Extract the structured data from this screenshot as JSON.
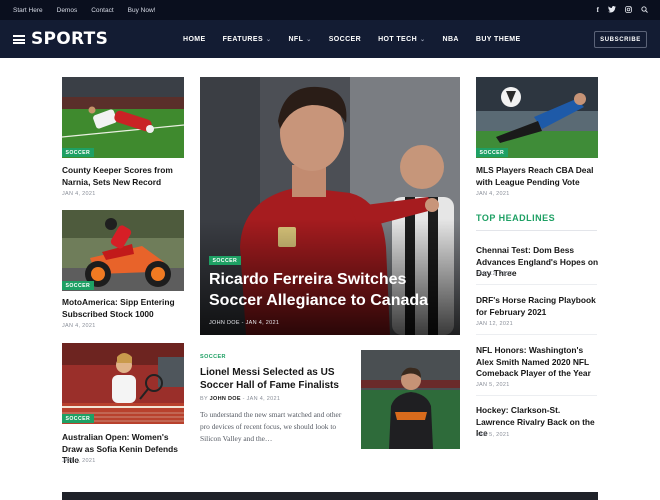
{
  "topbar": {
    "links": [
      "Start Here",
      "Demos",
      "Contact",
      "Buy Now!"
    ],
    "icons": [
      "facebook-icon",
      "twitter-icon",
      "instagram-icon",
      "search-icon"
    ]
  },
  "header": {
    "logo": "SPORTS",
    "nav": [
      {
        "label": "HOME",
        "dropdown": false
      },
      {
        "label": "FEATURES",
        "dropdown": true
      },
      {
        "label": "NFL",
        "dropdown": true
      },
      {
        "label": "SOCCER",
        "dropdown": false
      },
      {
        "label": "HOT TECH",
        "dropdown": true
      },
      {
        "label": "NBA",
        "dropdown": false
      },
      {
        "label": "BUY THEME",
        "dropdown": false
      }
    ],
    "subscribe_label": "SUBSCRIBE"
  },
  "left_column": [
    {
      "category": "SOCCER",
      "title": "County Keeper Scores from Narnia, Sets New Record",
      "date": "JAN 4, 2021"
    },
    {
      "category": "SOCCER",
      "title": "MotoAmerica: Sipp Entering Subscribed Stock 1000",
      "date": "JAN 4, 2021"
    },
    {
      "category": "SOCCER",
      "title": "Australian Open: Women's Draw as Sofia Kenin Defends Title",
      "date": "JAN 4, 2021"
    }
  ],
  "feature": {
    "category": "SOCCER",
    "title": "Ricardo Ferreira Switches Soccer Allegiance to Canada",
    "author": "JOHN DOE",
    "date": "JAN 4, 2021"
  },
  "middle_post": {
    "category": "SOCCER",
    "title": "Lionel Messi Selected as US Soccer Hall of Fame Finalists",
    "by": "BY",
    "author": "JOHN DOE",
    "date": "JAN 4, 2021",
    "excerpt": "To understand the new smart watched and other pro devices of recent focus, we should look to Silicon Valley and the…"
  },
  "right_top": {
    "category": "SOCCER",
    "title": "MLS Players Reach CBA Deal with League Pending Vote",
    "date": "JAN 4, 2021"
  },
  "top_headlines": {
    "heading": "TOP HEADLINES",
    "items": [
      {
        "title": "Chennai Test: Dom Bess Advances England's Hopes on Day Three",
        "date": "JAN 12, 2021"
      },
      {
        "title": "DRF's Horse Racing Playbook for February 2021",
        "date": "JAN 12, 2021"
      },
      {
        "title": "NFL Honors: Washington's Alex Smith Named 2020 NFL Comeback Player of the Year",
        "date": "JAN 5, 2021"
      },
      {
        "title": "Hockey: Clarkson-St. Lawrence Rivalry Back on the Ice",
        "date": "JAN 5, 2021"
      }
    ]
  },
  "colors": {
    "accent": "#1ea064",
    "nav_bg": "#131c33",
    "topbar_bg": "#0a0f1e"
  }
}
